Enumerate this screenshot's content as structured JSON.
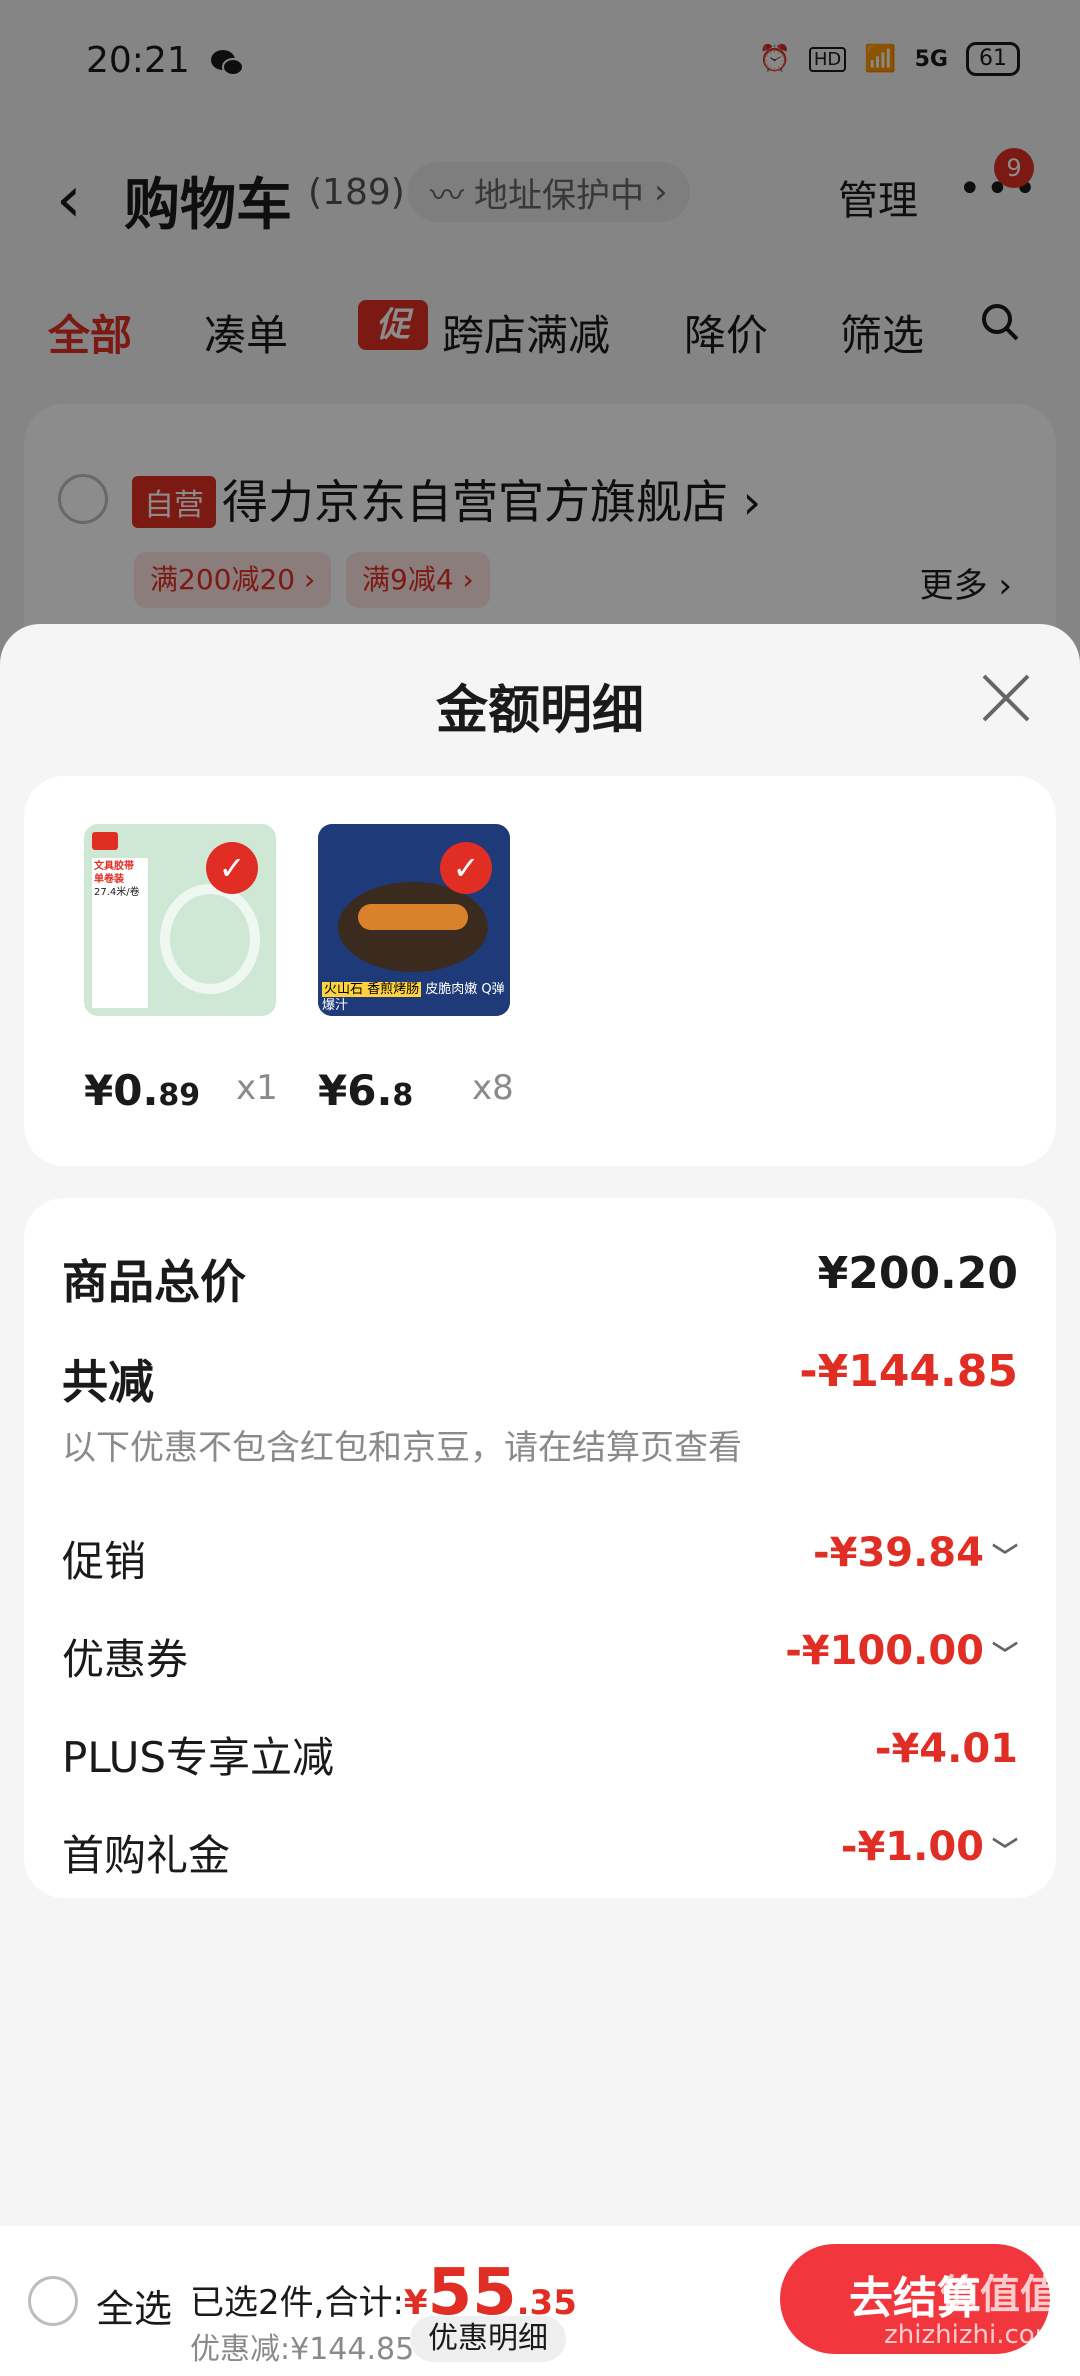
{
  "status_bar": {
    "time": "20:21",
    "battery": "61",
    "network": "5G",
    "hd": "HD"
  },
  "header": {
    "back_icon": "chevron-left",
    "title": "购物车",
    "count": "(189)",
    "address_protect": "地址保护中",
    "manage": "管理",
    "more_badge": "9"
  },
  "filters": {
    "all": "全部",
    "combine": "凑单",
    "promo_badge": "促",
    "cross_store": "跨店满减",
    "price_drop": "降价",
    "screen": "筛选"
  },
  "store": {
    "tag": "自营",
    "name": "得力京东自营官方旗舰店",
    "promo1": "满200减20",
    "promo2": "满9减4",
    "more": "更多"
  },
  "sheet": {
    "title": "金额明细",
    "items": [
      {
        "price_int": "¥0.",
        "price_dec": "89",
        "qty": "x1",
        "img_text_top": "文具胶带 单卷装",
        "img_text_mid": "27.4米/卷"
      },
      {
        "price_int": "¥6.",
        "price_dec": "8",
        "qty": "x8",
        "img_text_top": "火山石 香煎烤肠",
        "img_text_mid": "皮脆肉嫩 Q弹爆汁"
      }
    ],
    "summary": {
      "goods_total_label": "商品总价",
      "goods_total": "¥200.20",
      "reduce_label": "共减",
      "reduce_total": "-¥144.85",
      "note": "以下优惠不包含红包和京豆，请在结算页查看",
      "rows": [
        {
          "label": "促销",
          "value": "-¥39.84",
          "chev": "﹀"
        },
        {
          "label": "优惠券",
          "value": "-¥100.00",
          "chev": "﹀"
        },
        {
          "label": "PLUS专享立减",
          "value": "-¥4.01",
          "chev": ""
        },
        {
          "label": "首购礼金",
          "value": "-¥1.00",
          "chev": "﹀"
        }
      ]
    }
  },
  "bottom": {
    "select_all": "全选",
    "selected_prefix": "已选2件,合计:",
    "currency": "¥",
    "total_int": "55",
    "total_dec": ".35",
    "discount": "优惠减:¥144.85",
    "detail": "优惠明细",
    "checkout": "去结算"
  },
  "watermark": {
    "line1": "值值值",
    "line2": "zhizhizhi.com"
  },
  "colors": {
    "accent": "#e02e24",
    "checkout": "#f2363d"
  }
}
